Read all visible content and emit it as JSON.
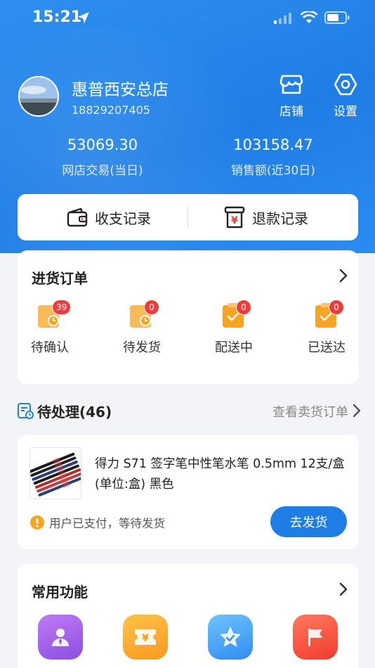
{
  "status": {
    "time": "15:21"
  },
  "store": {
    "name": "惠普西安总店",
    "phone": "18829207405"
  },
  "header_actions": {
    "shop_label": "店铺",
    "settings_label": "设置"
  },
  "stats": [
    {
      "value": "53069.30",
      "caption": "网店交易(当日)"
    },
    {
      "value": "103158.47",
      "caption": "销售额(近30日)"
    }
  ],
  "records": {
    "income_expense": "收支记录",
    "refund": "退款记录"
  },
  "purchase_orders": {
    "title": "进货订单",
    "items": [
      {
        "label": "待确认",
        "count": "39"
      },
      {
        "label": "待发货",
        "count": "0"
      },
      {
        "label": "配送中",
        "count": "0"
      },
      {
        "label": "已送达",
        "count": "0"
      }
    ]
  },
  "pending": {
    "title": "待处理(46)",
    "view_link": "查看卖货订单",
    "product_name": "得力 S71 签字笔中性笔水笔 0.5mm 12支/盒 (单位:盒) 黑色",
    "notice": "用户已支付，等待发货",
    "ship_button": "去发货"
  },
  "common_functions": {
    "title": "常用功能"
  },
  "colors": {
    "primary": "#1f7ee6",
    "badge": "#f33a3a",
    "orange": "#f7a423"
  }
}
